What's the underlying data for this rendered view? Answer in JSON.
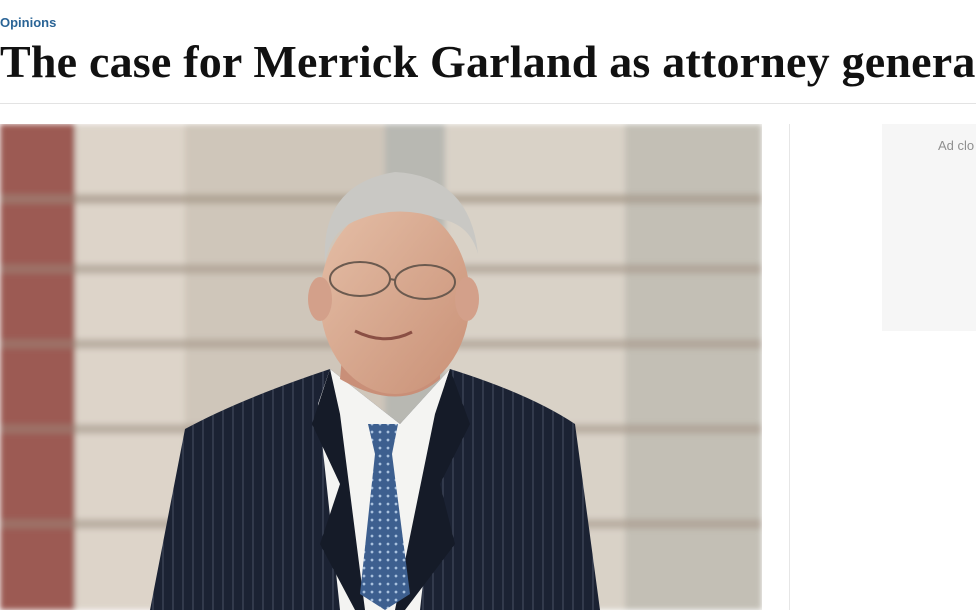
{
  "article": {
    "section": "Opinions",
    "headline": "The case for Merrick Garland as attorney general"
  },
  "ad": {
    "close_label": "Ad clo"
  }
}
